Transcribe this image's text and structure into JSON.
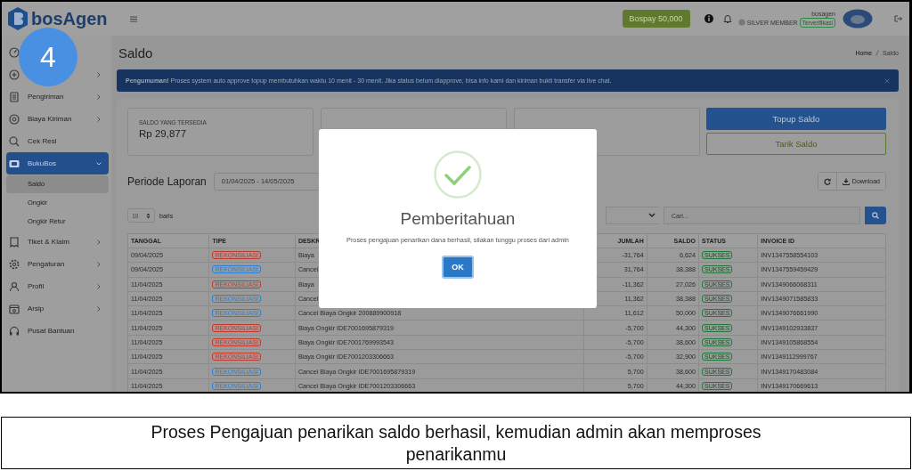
{
  "header": {
    "logo": "bosAgen",
    "bospay": "Bospay  50,000",
    "member_level": "SILVER MEMBER",
    "username": "bosagen",
    "verified": "Terverifikasi"
  },
  "step_badge": "4",
  "sidebar": {
    "items": [
      {
        "selected": false
      },
      {
        "expandable": true,
        "selected": false
      },
      {
        "label": "Pengiriman",
        "expandable": true,
        "selected": false
      },
      {
        "label": "Biaya Kiriman",
        "expandable": true,
        "selected": false
      },
      {
        "label": "Cek Resi",
        "expandable": false,
        "selected": false
      },
      {
        "label": "BukuBos",
        "expandable": true,
        "selected": true,
        "expanded": true,
        "children": [
          {
            "label": "Saldo",
            "selected": true
          },
          {
            "label": "Ongkir",
            "selected": false
          },
          {
            "label": "Ongkir Retur",
            "selected": false
          }
        ]
      },
      {
        "label": "Tiket & Klaim",
        "expandable": true,
        "selected": false
      },
      {
        "label": "Pengaturan",
        "expandable": true,
        "selected": false
      },
      {
        "label": "Profil",
        "expandable": true,
        "selected": false
      },
      {
        "label": "Arsip",
        "expandable": true,
        "selected": false
      },
      {
        "label": "Pusat Bantuan",
        "expandable": false,
        "selected": false
      }
    ]
  },
  "page": {
    "title": "Saldo",
    "breadcrumb": [
      "Home",
      "Saldo"
    ],
    "announcement": "**Pengumuman!** Proses system auto approve topup membutuhkan waktu 10 menit - 30 menit. Jika status belum diapprove, bisa info kami dan kiriman bukti transfer via live chat.",
    "cards": [
      {
        "kind": "balance",
        "label": "SALDO YANG TERSEDIA",
        "value": "Rp 29,877"
      },
      {
        "kind": "covered"
      },
      {
        "kind": "covered"
      }
    ],
    "buttons": [
      "Topup Saldo",
      "Tarik Saldo"
    ],
    "period_label": "Periode Laporan",
    "period_value": "01/04/2025 - 14/05/2025",
    "download": "Download",
    "per_page": "10",
    "per_page_suffix": "baris",
    "search_placeholder": "Cari..."
  },
  "table": {
    "columns": [
      "TANGGAL",
      "TIPE",
      "DESKR",
      "JUMLAH",
      "SALDO",
      "STATUS",
      "INVOICE ID"
    ],
    "rows": [
      {
        "tanggal": "09/04/2025",
        "tipe": "REKONSILIASI",
        "color": "#c0392b",
        "deskripsi": "Biaya",
        "jumlah": "-31,764",
        "saldo": "6,624",
        "status": "SUKSES",
        "invoice": "INV1347558554103"
      },
      {
        "tanggal": "09/04/2025",
        "tipe": "REKONSILIASI",
        "color": "#2f7fd0",
        "deskripsi": "Cancel",
        "jumlah": "31,764",
        "saldo": "38,388",
        "status": "SUKSES",
        "invoice": "INV1347559459429"
      },
      {
        "tanggal": "11/04/2025",
        "tipe": "REKONSILIASI",
        "color": "#c0392b",
        "deskripsi": "Biaya",
        "jumlah": "-11,362",
        "saldo": "27,026",
        "status": "SUKSES",
        "invoice": "INV1349066068311"
      },
      {
        "tanggal": "11/04/2025",
        "tipe": "REKONSILIASI",
        "color": "#2f7fd0",
        "deskripsi": "Cancel",
        "jumlah": "11,362",
        "saldo": "38,388",
        "status": "SUKSES",
        "invoice": "INV1349071585833"
      },
      {
        "tanggal": "11/04/2025",
        "tipe": "REKONSILIASI",
        "color": "#2f7fd0",
        "deskripsi": "Cancel Biaya Ongkir 200889900918",
        "jumlah": "11,612",
        "saldo": "50,000",
        "status": "SUKSES",
        "invoice": "INV1349076661990"
      },
      {
        "tanggal": "11/04/2025",
        "tipe": "REKONSILIASI",
        "color": "#c0392b",
        "deskripsi": "Biaya Ongkir IDE7001695879319",
        "jumlah": "-5,700",
        "saldo": "44,300",
        "status": "SUKSES",
        "invoice": "INV1349102933837"
      },
      {
        "tanggal": "11/04/2025",
        "tipe": "REKONSILIASI",
        "color": "#c0392b",
        "deskripsi": "Biaya Ongkir IDE7001769993543",
        "jumlah": "-5,700",
        "saldo": "38,600",
        "status": "SUKSES",
        "invoice": "INV1349105868554"
      },
      {
        "tanggal": "11/04/2025",
        "tipe": "REKONSILIASI",
        "color": "#c0392b",
        "deskripsi": "Biaya Ongkir IDE7001203306663",
        "jumlah": "-5,700",
        "saldo": "32,900",
        "status": "SUKSES",
        "invoice": "INV1349112999767"
      },
      {
        "tanggal": "11/04/2025",
        "tipe": "REKONSILIASI",
        "color": "#2f7fd0",
        "deskripsi": "Cancel Biaya Ongkir IDE7001695879319",
        "jumlah": "5,700",
        "saldo": "38,600",
        "status": "SUKSES",
        "invoice": "INV1349170483084"
      },
      {
        "tanggal": "11/04/2025",
        "tipe": "REKONSILIASI",
        "color": "#2f7fd0",
        "deskripsi": "Cancel Biaya Ongkir IDE7001203306663",
        "jumlah": "5,700",
        "saldo": "44,300",
        "status": "SUKSES",
        "invoice": "INV1349170669613"
      }
    ]
  },
  "modal": {
    "title": "Pemberitahuan",
    "message": "Proses pengajuan penarikan dana berhasil, silakan tunggu proses dari admin",
    "button": "OK"
  },
  "caption": "Proses Pengajuan penarikan saldo berhasil, kemudian admin akan memproses penarikanmu"
}
